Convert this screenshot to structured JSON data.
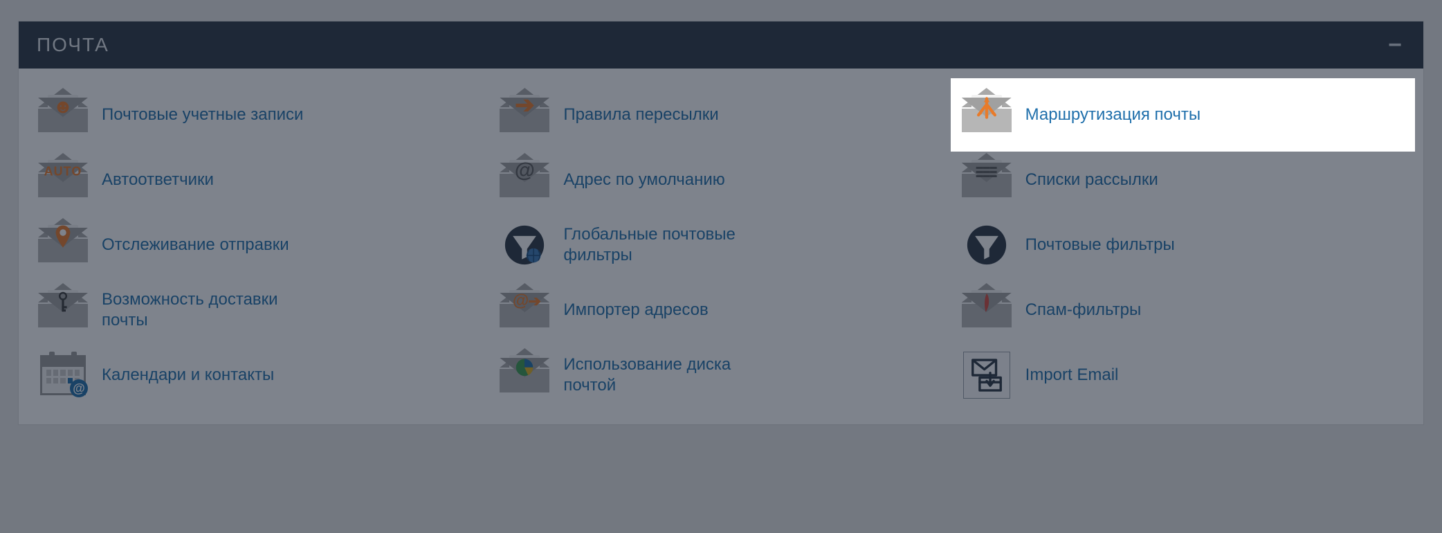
{
  "panel": {
    "title": "ПОЧТА"
  },
  "items": [
    {
      "id": "email-accounts",
      "label": "Почтовые учетные записи",
      "icon": "person",
      "highlight": false
    },
    {
      "id": "forwarders",
      "label": "Правила пересылки",
      "icon": "arrow",
      "highlight": false
    },
    {
      "id": "email-routing",
      "label": "Маршрутизация почты",
      "icon": "routing",
      "highlight": true
    },
    {
      "id": "autoresponders",
      "label": "Автоответчики",
      "icon": "auto",
      "highlight": false
    },
    {
      "id": "default-address",
      "label": "Адрес по умолчанию",
      "icon": "at",
      "highlight": false
    },
    {
      "id": "mailing-lists",
      "label": "Списки рассылки",
      "icon": "list",
      "highlight": false
    },
    {
      "id": "track-delivery",
      "label": "Отслеживание отправки",
      "icon": "pin",
      "highlight": false
    },
    {
      "id": "global-filters",
      "label": "Глобальные почтовые фильтры",
      "icon": "funnel-globe",
      "highlight": false
    },
    {
      "id": "email-filters",
      "label": "Почтовые фильтры",
      "icon": "funnel",
      "highlight": false
    },
    {
      "id": "deliverability",
      "label": "Возможность доставки почты",
      "icon": "key",
      "highlight": false
    },
    {
      "id": "address-importer",
      "label": "Импортер адресов",
      "icon": "at-arrow",
      "highlight": false
    },
    {
      "id": "spam-filters",
      "label": "Спам-фильтры",
      "icon": "feather",
      "highlight": false
    },
    {
      "id": "calendars-contacts",
      "label": "Календари и контакты",
      "icon": "calendar",
      "highlight": false
    },
    {
      "id": "email-disk-usage",
      "label": "Использование диска почтой",
      "icon": "pie",
      "highlight": false
    },
    {
      "id": "import-email",
      "label": "Import Email",
      "icon": "import",
      "highlight": false
    }
  ]
}
